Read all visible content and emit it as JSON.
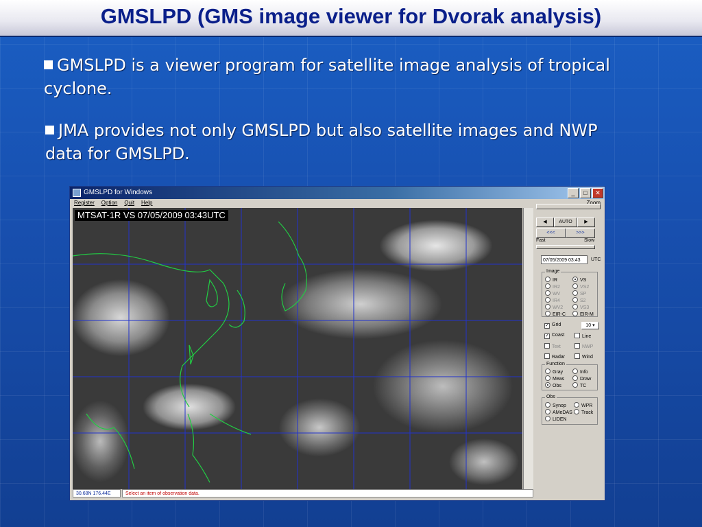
{
  "slide": {
    "title": "GMSLPD (GMS image viewer for Dvorak analysis)",
    "bullets": [
      "GMSLPD is a viewer program for satellite image analysis of tropical cyclone.",
      "JMA provides not only GMSLPD but also satellite images and NWP data for GMSLPD."
    ]
  },
  "window": {
    "title": "GMSLPD for Windows",
    "menu": [
      "Register",
      "Option",
      "Quit",
      "Help"
    ],
    "zoom_label": "Zoom",
    "image_label": "MTSAT-1R VS 07/05/2009 03:43UTC",
    "controls": {
      "prev": "◀",
      "auto": "AUTO",
      "next": "▶",
      "rewind": "<<<",
      "forward": ">>>",
      "fast": "Fast",
      "slow": "Slow",
      "datetime": "07/05/2009 03:43",
      "utc": "UTC"
    },
    "image_group": {
      "title": "Image",
      "left": [
        {
          "label": "IR",
          "on": false,
          "disabled": false
        },
        {
          "label": "IR2",
          "on": false,
          "disabled": true
        },
        {
          "label": "WV",
          "on": false,
          "disabled": true
        },
        {
          "label": "IR4",
          "on": false,
          "disabled": true
        },
        {
          "label": "WV2",
          "on": false,
          "disabled": true
        },
        {
          "label": "EIR-C",
          "on": false,
          "disabled": false
        }
      ],
      "right": [
        {
          "label": "VS",
          "on": true,
          "disabled": false
        },
        {
          "label": "VS2",
          "on": false,
          "disabled": true
        },
        {
          "label": "SP",
          "on": false,
          "disabled": true
        },
        {
          "label": "S2",
          "on": false,
          "disabled": true
        },
        {
          "label": "VS3",
          "on": false,
          "disabled": true
        },
        {
          "label": "EIR-M",
          "on": false,
          "disabled": false
        }
      ]
    },
    "overlays": {
      "grid": "Grid",
      "grid_value": "10",
      "coast": "Coast",
      "line": "Line",
      "text": "Text",
      "nwp": "NWP",
      "radar": "Radar",
      "wind": "Wind"
    },
    "function_group": {
      "title": "Function",
      "left": [
        "Gray",
        "Meas",
        "Obs"
      ],
      "right": [
        "Info",
        "Draw",
        "TC"
      ],
      "selected": "Obs"
    },
    "obs_group": {
      "title": "Obs",
      "left": [
        "Synop",
        "AMeDAS",
        "LIDEN"
      ],
      "right": [
        "WPR",
        "Track"
      ]
    },
    "status": {
      "coords": "30.68N 176.44E",
      "message": "Select an item of observation data."
    }
  },
  "colors": {
    "slide_bg": "#1850b0",
    "title_text": "#0a1f8a",
    "coast": "#22cc44",
    "grid": "#2233cc"
  }
}
